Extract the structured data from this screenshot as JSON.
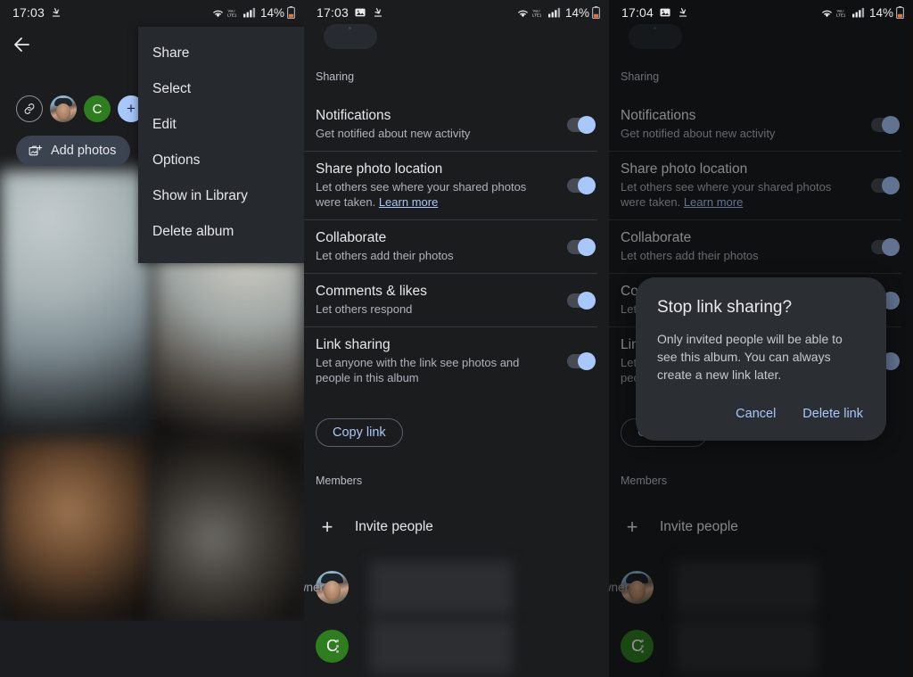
{
  "panels": [
    {
      "id": "album-menu",
      "statusbar": {
        "time": "17:03",
        "battery": "14%",
        "icons": [
          "download-icon",
          "wifi-icon",
          "volte-icon",
          "signal-icon",
          "battery-icon"
        ]
      },
      "back_label": "back",
      "avatars": [
        {
          "type": "link",
          "label": ""
        },
        {
          "type": "photo",
          "label": ""
        },
        {
          "type": "initial",
          "label": "C"
        },
        {
          "type": "plus",
          "label": "+"
        }
      ],
      "add_photos_label": "Add photos",
      "menu_items": [
        "Share",
        "Select",
        "Edit",
        "Options",
        "Show in Library",
        "Delete album"
      ]
    },
    {
      "id": "sharing-settings",
      "statusbar": {
        "time": "17:03",
        "battery": "14%",
        "icons": [
          "image-icon",
          "download-icon",
          "wifi-icon",
          "volte-icon",
          "signal-icon",
          "battery-icon"
        ]
      },
      "section_sharing": "Sharing",
      "settings": [
        {
          "title": "Notifications",
          "sub": "Get notified about new activity",
          "link": "",
          "toggle": true
        },
        {
          "title": "Share photo location",
          "sub": "Let others see where your shared photos were taken. ",
          "link": "Learn more",
          "toggle": true
        },
        {
          "title": "Collaborate",
          "sub": "Let others add their photos",
          "link": "",
          "toggle": true
        },
        {
          "title": "Comments & likes",
          "sub": "Let others respond",
          "link": "",
          "toggle": true
        },
        {
          "title": "Link sharing",
          "sub": "Let anyone with the link see photos and people in this album",
          "link": "",
          "toggle": true
        }
      ],
      "copy_link_label": "Copy link",
      "section_members": "Members",
      "invite_label": "Invite people",
      "members": [
        {
          "avatar": "photo",
          "initial": "",
          "role": "Owner",
          "menu": false
        },
        {
          "avatar": "green",
          "initial": "C",
          "role": "",
          "menu": true
        }
      ]
    },
    {
      "id": "stop-link-sharing-dialog",
      "statusbar": {
        "time": "17:04",
        "battery": "14%",
        "icons": [
          "image-icon",
          "download-icon",
          "wifi-icon",
          "volte-icon",
          "signal-icon",
          "battery-icon"
        ]
      },
      "dialog": {
        "title": "Stop link sharing?",
        "body": "Only invited people will be able to see this album. You can always create a new link later.",
        "cancel": "Cancel",
        "confirm": "Delete link"
      }
    }
  ],
  "colors": {
    "background": "#1b1c1e",
    "menu_background": "#262a2e",
    "accent_blue": "#a8c7fa",
    "toggle_track": "#464b53",
    "chip": "#3b4351",
    "green_avatar": "#2e7d1f",
    "dialog_background": "#2b2f34"
  }
}
